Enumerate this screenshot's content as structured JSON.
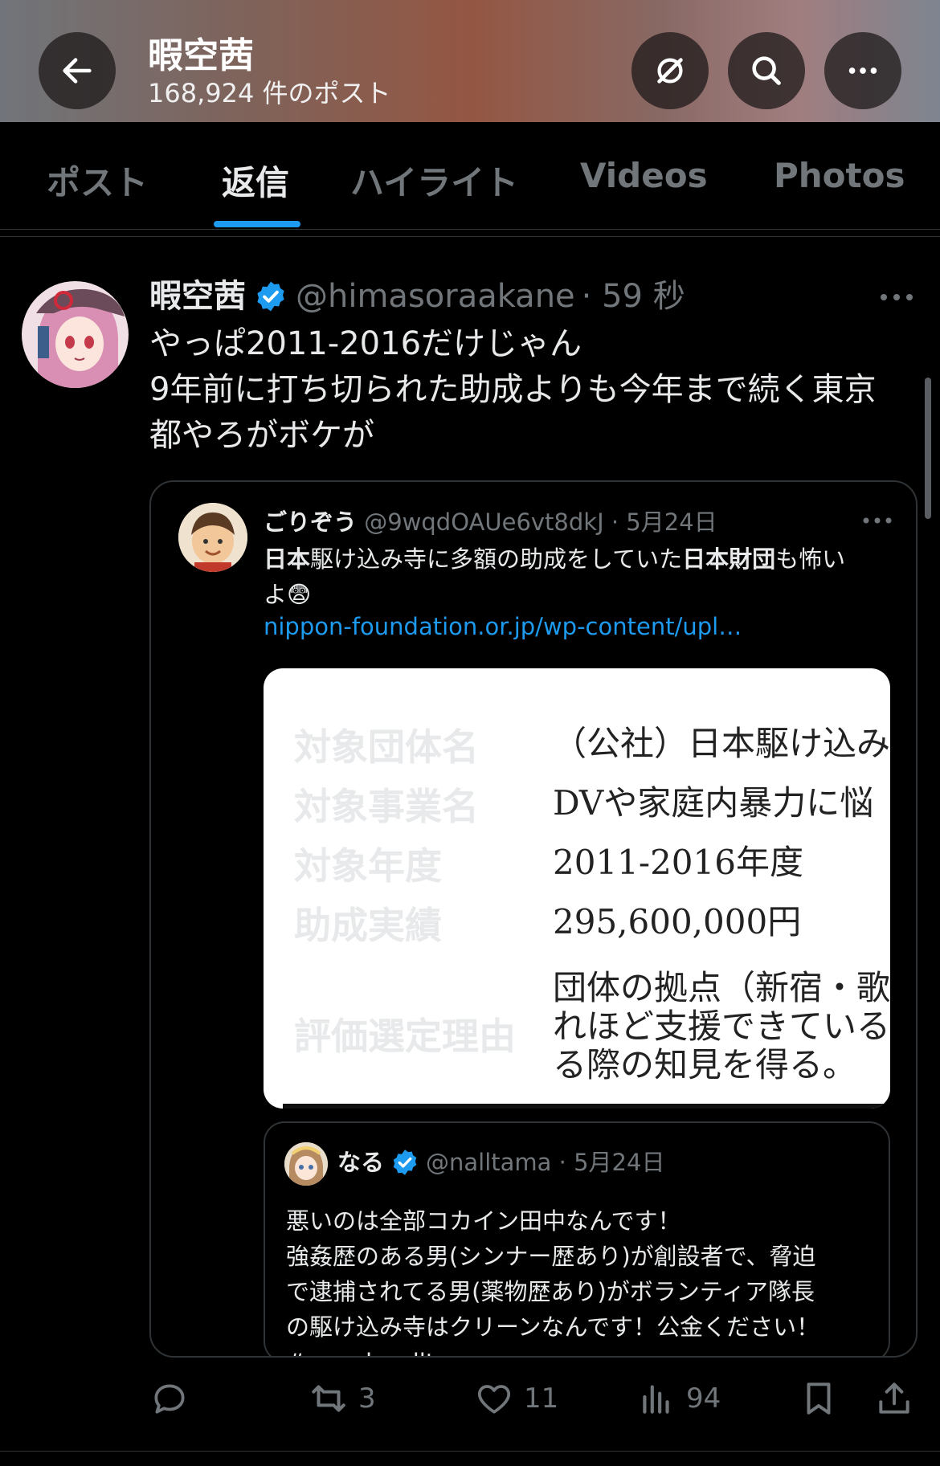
{
  "header": {
    "name": "暇空茜",
    "post_count": "168,924 件のポスト",
    "colors": {
      "back_button_bg": "#1e1a1a"
    }
  },
  "tabs": [
    {
      "label": "ポスト",
      "active": false
    },
    {
      "label": "返信",
      "active": true
    },
    {
      "label": "ハイライト",
      "active": false
    },
    {
      "label": "Videos",
      "active": false
    },
    {
      "label": "Photos",
      "active": false
    }
  ],
  "tweet": {
    "name": "暇空茜",
    "handle": "@himasoraakane",
    "time": "· 59 秒",
    "text_lines": [
      "やっぱ2011-2016だけじゃん",
      "9年前に打ち切られた助成よりも今年まで続く東京",
      "都やろがボケが"
    ],
    "quote": {
      "name": "ごりぞう",
      "handle": "@9wqdOAUe6vt8dkJ · 5月24日",
      "text_part1": "日本",
      "text_part2": "駆け込み寺に多額の助成をしていた",
      "text_part3": "日本財団",
      "text_part4": "も怖い",
      "text_part5": "よ😨",
      "link": "nippon-foundation.or.jp/wp-content/upl…",
      "doc": {
        "rows": [
          {
            "label": "対象団体名",
            "value": "（公社）日本駆け込み"
          },
          {
            "label": "対象事業名",
            "value": "DVや家庭内暴力に悩"
          },
          {
            "label": "対象年度",
            "value": "2011-2016年度"
          },
          {
            "label": "助成実績",
            "value": "295,600,000円"
          },
          {
            "label": "評価選定理由",
            "value_lines": [
              "団体の拠点（新宿・歌舞",
              "れほど支援できているの",
              "る際の知見を得る。"
            ]
          }
        ]
      },
      "inner": {
        "name": "なる",
        "handle": "@nalltama · 5月24日",
        "lines": [
          "悪いのは全部コカイン田中なんです！",
          "強姦歴のある男(シンナー歴あり)が創設者で、脅迫",
          "で逮捕されてる男(薬物歴あり)がボランティア隊長",
          "の駆け込み寺はクリーンなんです！公金ください！",
          "#mond_nalltama"
        ]
      }
    },
    "actions": {
      "replies": "",
      "reposts": "3",
      "likes": "11",
      "views": "94"
    }
  },
  "colors": {
    "accent": "#1d9bf0",
    "muted": "#71767b",
    "text": "#e7e9ea",
    "bg": "#000000"
  }
}
